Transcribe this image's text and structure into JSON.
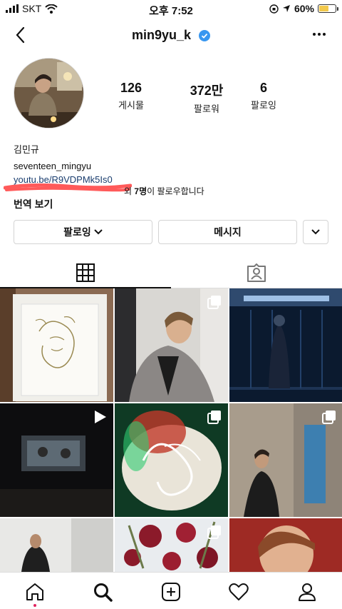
{
  "status_bar": {
    "carrier": "SKT",
    "time": "오후 7:52",
    "battery": "60%",
    "battery_level": 0.6
  },
  "header": {
    "username": "min9yu_k"
  },
  "stats": [
    {
      "value": "126",
      "label": "게시물"
    },
    {
      "value": "372만",
      "label": "팔로워"
    },
    {
      "value": "6",
      "label": "팔로잉"
    }
  ],
  "bio": {
    "name": "김민규",
    "line": "seventeen_mingyu",
    "link": "youtu.be/R9VDPMk5Is0",
    "followed_by_pre": "외",
    "followed_by_count": "7명",
    "followed_by_post": "이 팔로우합니다",
    "translate": "번역 보기"
  },
  "buttons": {
    "following": "팔로잉",
    "message": "메시지"
  },
  "tabs": [
    {
      "icon": "grid-icon"
    },
    {
      "icon": "tagged-icon"
    }
  ],
  "colors": {
    "verified": "#3897f0",
    "link": "#1a3d6e",
    "notification_dot": "#e0245e",
    "redaction": "#ff5a5a"
  }
}
